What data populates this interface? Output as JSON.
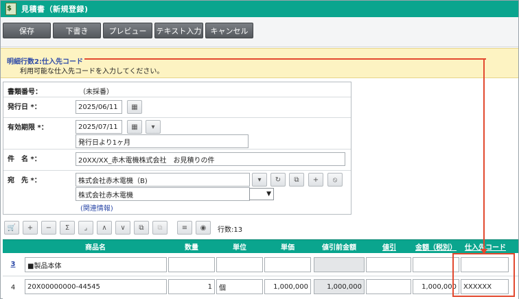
{
  "window": {
    "title": "見積書（新規登録)"
  },
  "toolbar": {
    "save": "保存",
    "draft": "下書き",
    "preview": "プレビュー",
    "text_input": "テキスト入力",
    "cancel": "キャンセル"
  },
  "info": {
    "title": "明細行数2:仕入先コード",
    "message": "利用可能な仕入先コードを入力してください。"
  },
  "form": {
    "doc_number_label": "書類番号：",
    "doc_number_value": "（未採番）",
    "issue_date_label": "発行日 *：",
    "issue_date_value": "2025/06/11",
    "expiry_label": "有効期限 *：",
    "expiry_value": "2025/07/11",
    "expiry_note": "発行日より1ヶ月",
    "subject_label": "件　名 *：",
    "subject_value": "20XX/XX_赤木電機株式会社　お見積りの件",
    "to_label": "宛　先 *：",
    "to_company": "株式会社赤木電機（B)",
    "to_company_name": "株式会社赤木電機",
    "related_link": "(関連情報)"
  },
  "grid_toolbar": {
    "row_count": "行数:13"
  },
  "grid": {
    "columns": [
      "商品名",
      "数量",
      "単位",
      "単価",
      "値引前金額",
      "値引",
      "金額（税別）",
      "仕入先コード"
    ],
    "rows": [
      {
        "num": "3",
        "product": "■製品本体",
        "qty": "",
        "unit": "",
        "price": "",
        "pre_discount": "",
        "discount": "",
        "amount": "",
        "supplier": ""
      },
      {
        "num": "4",
        "product": "20X00000000-44545",
        "qty": "1",
        "unit": "個",
        "price": "1,000,000",
        "pre_discount": "1,000,000",
        "discount": "",
        "amount": "1,000,000",
        "supplier": "XXXXXX"
      }
    ]
  },
  "colors": {
    "accent": "#0aa58e",
    "callout": "#e2482e",
    "info_bg": "#fdf3c2"
  },
  "icons": [
    "app-icon",
    "calendar-icon",
    "dropdown-icon",
    "refresh-icon",
    "copy-icon",
    "plus-icon",
    "clear-icon",
    "cart-icon",
    "minus-icon",
    "sigma-icon",
    "up-icon",
    "down-icon",
    "eye-icon"
  ]
}
